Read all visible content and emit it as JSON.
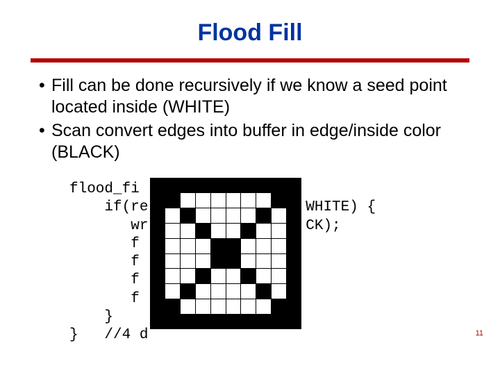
{
  "title": "Flood Fill",
  "bullets": [
    "Fill can be done recursively if we know a seed point located inside (WHITE)",
    "Scan convert edges into buffer in edge/inside color (BLACK)"
  ],
  "code_visible": {
    "l0": "flood_fi",
    "l1": "    if(re                  WHITE) {",
    "l2": "       wr                  CK);",
    "l3": "       f",
    "l4": "       f",
    "l5": "       f",
    "l6": "       f",
    "l7": "    }",
    "l8": "}   //4 d"
  },
  "flood_grid_black_cells": [
    [
      0,
      0
    ],
    [
      0,
      7
    ],
    [
      1,
      1
    ],
    [
      1,
      6
    ],
    [
      2,
      2
    ],
    [
      2,
      5
    ],
    [
      3,
      3
    ],
    [
      3,
      4
    ],
    [
      4,
      3
    ],
    [
      4,
      4
    ],
    [
      5,
      2
    ],
    [
      5,
      5
    ],
    [
      6,
      1
    ],
    [
      6,
      6
    ],
    [
      7,
      0
    ],
    [
      7,
      7
    ]
  ],
  "page_number": "11"
}
